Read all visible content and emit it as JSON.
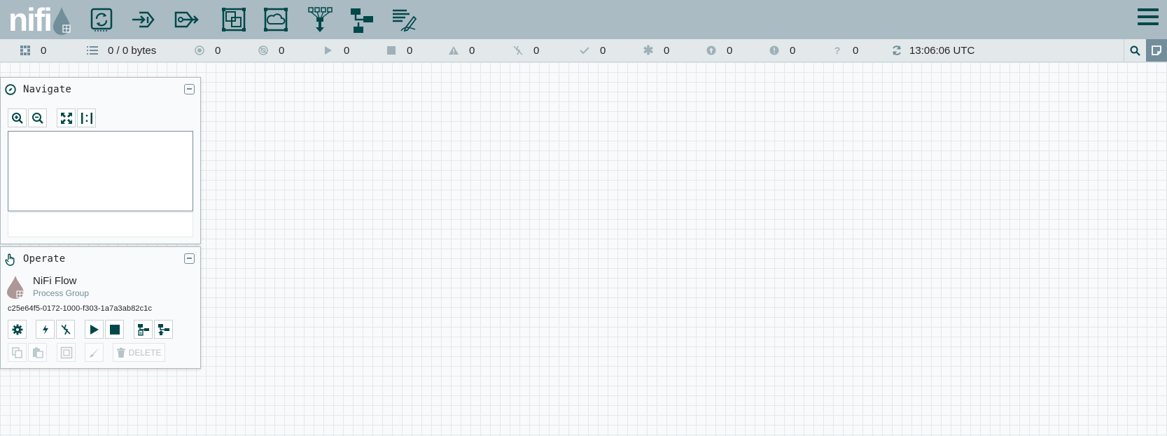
{
  "logo": {
    "text_a": "ni",
    "text_b": "fi"
  },
  "toolbar": [
    {
      "name": "processor-icon",
      "label": "Processor"
    },
    {
      "name": "input-port-icon",
      "label": "Input Port"
    },
    {
      "name": "output-port-icon",
      "label": "Output Port"
    },
    {
      "name": "process-group-icon",
      "label": "Process Group"
    },
    {
      "name": "remote-process-group-icon",
      "label": "Remote Process Group"
    },
    {
      "name": "funnel-icon",
      "label": "Funnel"
    },
    {
      "name": "template-icon",
      "label": "Template"
    },
    {
      "name": "label-icon",
      "label": "Label"
    }
  ],
  "status": {
    "cluster_nodes": "0",
    "queued": "0 / 0 bytes",
    "transmitting": "0",
    "not_transmitting": "0",
    "running": "0",
    "stopped": "0",
    "invalid": "0",
    "disabled": "0",
    "up_to_date": "0",
    "locally_modified": "0",
    "stale": "0",
    "locally_modified_stale": "0",
    "sync_failure": "0",
    "time": "13:06:06 UTC"
  },
  "navigate": {
    "title": "Navigate"
  },
  "operate": {
    "title": "Operate",
    "component_name": "NiFi Flow",
    "component_type": "Process Group",
    "component_id": "c25e64f5-0172-1000-f303-1a7a3ab82c1c",
    "delete_label": "DELETE"
  },
  "colors": {
    "header": "#aabbc3",
    "accent": "#004849",
    "muted": "#728e9b",
    "statusbar": "#e3e8eb"
  }
}
